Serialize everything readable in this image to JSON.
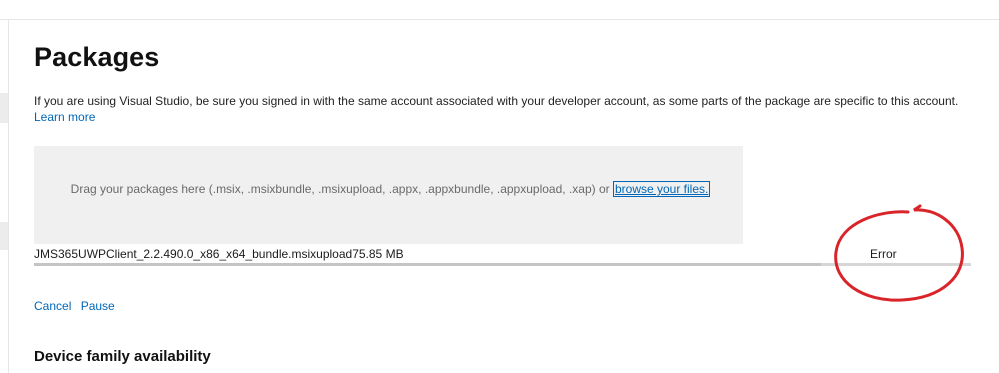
{
  "page": {
    "title": "Packages",
    "intro": "If you are using Visual Studio, be sure you signed in with the same account associated with your developer account, as some parts of the package are specific to this account.",
    "learn_more": "Learn more"
  },
  "dropzone": {
    "text": "Drag your packages here (.msix, .msixbundle, .msixupload, .appx, .appxbundle, .appxupload, .xap) or",
    "browse_link": "browse your files."
  },
  "upload": {
    "file_name": "JMS365UWPClient_2.2.490.0_x86_x64_bundle.msixupload",
    "file_size": "75.85 MB",
    "status": "Error",
    "progress_fraction": 0.84,
    "actions": {
      "cancel": "Cancel",
      "pause": "Pause"
    }
  },
  "sections": {
    "device_family_heading": "Device family availability"
  },
  "colors": {
    "link": "#0067b8",
    "annotation": "#d9252a",
    "dropzone_bg": "#f0f0f0"
  }
}
